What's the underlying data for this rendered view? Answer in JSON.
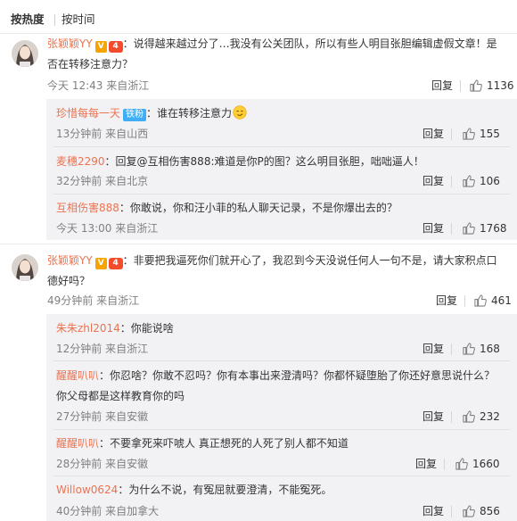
{
  "tabs": {
    "hot": "按热度",
    "time": "按时间"
  },
  "comments": [
    {
      "user": "张颖颖YY",
      "badge_v": "V",
      "badge_vip": "4",
      "text_line1": "：说得越来越过分了…我没有公关团队，所以有些人明目张胆编辑虚假文章！是",
      "text_line2": "否在转移注意力？",
      "time": "今天 12:43 来自浙江",
      "reply": "回复",
      "likes": "1136",
      "replies": [
        {
          "user": "珍惜每每一天",
          "badge": "铁粉",
          "text": "：谁在转移注意力",
          "emoji": "smirk-emoji",
          "time": "13分钟前 来自山西",
          "reply": "回复",
          "likes": "155"
        },
        {
          "user": "麦穗2290",
          "text": "：回复@互相伤害888:难道是你P的图？这么明目张胆，咄咄逼人！",
          "time": "32分钟前 来自北京",
          "reply": "回复",
          "likes": "106"
        },
        {
          "user": "互相伤害888",
          "text": "：你敢说，你和汪小菲的私人聊天记录，不是你爆出去的？",
          "time": "今天 13:00 来自浙江",
          "reply": "回复",
          "likes": "1768"
        }
      ]
    },
    {
      "user": "张颖颖YY",
      "badge_v": "V",
      "badge_vip": "4",
      "text_line1": "：非要把我逼死你们就开心了，我忍到今天没说任何人一句不是，请大家积点口",
      "text_line2": "德好吗？",
      "time": "49分钟前 来自浙江",
      "reply": "回复",
      "likes": "461",
      "replies": [
        {
          "user": "朱朱zhl2014",
          "text": "：你能说啥",
          "time": "12分钟前 来自浙江",
          "reply": "回复",
          "likes": "168"
        },
        {
          "user": "醒醒叭叭",
          "text_line1": "：你忍啥？你敢不忍吗？你有本事出来澄清吗？你都怀疑堕胎了你还好意思说什么？",
          "text_line2": "你父母都是这样教育你的吗",
          "time": "27分钟前 来自安徽",
          "reply": "回复",
          "likes": "232"
        },
        {
          "user": "醒醒叭叭",
          "text": "：不要拿死来吓唬人 真正想死的人死了别人都不知道",
          "time": "28分钟前 来自安徽",
          "reply": "回复",
          "likes": "1660"
        },
        {
          "user": "Willow0624",
          "text": "：为什么不说，有冤屈就要澄清，不能冤死。",
          "time": "40分钟前 来自加拿大",
          "reply": "回复",
          "likes": "856"
        }
      ]
    }
  ],
  "colors": {
    "username": "#eb7350",
    "meta": "#808080",
    "sub_bg": "#f2f2f5",
    "vip": "#f24c2b",
    "verified": "#f7a400",
    "fan": "#41aef4"
  }
}
